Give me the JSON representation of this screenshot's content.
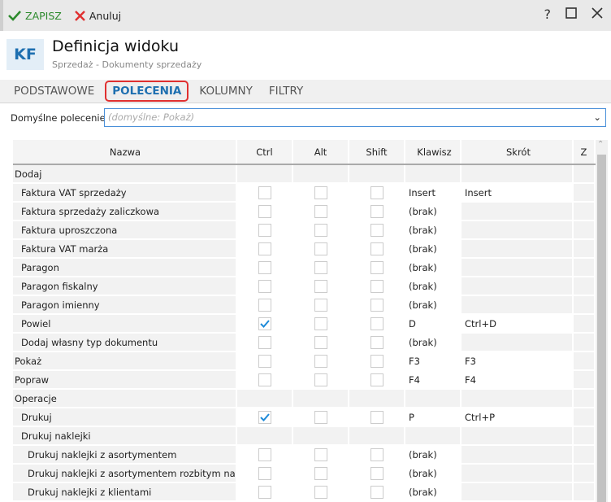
{
  "toolbar": {
    "save": "ZAPISZ",
    "cancel": "Anuluj",
    "help": "?"
  },
  "header": {
    "logo": "KF",
    "title": "Definicja widoku",
    "subtitle": "Sprzedaż - Dokumenty sprzedaży"
  },
  "tabs": [
    {
      "label": "PODSTAWOWE"
    },
    {
      "label": "POLECENIA",
      "active": true
    },
    {
      "label": "KOLUMNY"
    },
    {
      "label": "FILTRY"
    }
  ],
  "default_command": {
    "label": "Domyślne polecenie:",
    "placeholder": "(domyślne: Pokaż)"
  },
  "columns": [
    "Nazwa",
    "Ctrl",
    "Alt",
    "Shift",
    "Klawisz",
    "Skrót",
    "Z"
  ],
  "rows": [
    {
      "name": "Dodaj",
      "level": 0,
      "group": true
    },
    {
      "name": "Faktura VAT sprzedaży",
      "level": 1,
      "ctrl": false,
      "alt": false,
      "shift": false,
      "key": "Insert",
      "shortcut": "Insert"
    },
    {
      "name": "Faktura sprzedaży zaliczkowa",
      "level": 1,
      "ctrl": false,
      "alt": false,
      "shift": false,
      "key": "(brak)",
      "shortcut": ""
    },
    {
      "name": "Faktura uproszczona",
      "level": 1,
      "ctrl": false,
      "alt": false,
      "shift": false,
      "key": "(brak)",
      "shortcut": ""
    },
    {
      "name": "Faktura VAT marża",
      "level": 1,
      "ctrl": false,
      "alt": false,
      "shift": false,
      "key": "(brak)",
      "shortcut": ""
    },
    {
      "name": "Paragon",
      "level": 1,
      "ctrl": false,
      "alt": false,
      "shift": false,
      "key": "(brak)",
      "shortcut": ""
    },
    {
      "name": "Paragon fiskalny",
      "level": 1,
      "ctrl": false,
      "alt": false,
      "shift": false,
      "key": "(brak)",
      "shortcut": ""
    },
    {
      "name": "Paragon imienny",
      "level": 1,
      "ctrl": false,
      "alt": false,
      "shift": false,
      "key": "(brak)",
      "shortcut": ""
    },
    {
      "name": "Powiel",
      "level": 1,
      "ctrl": true,
      "alt": false,
      "shift": false,
      "key": "D",
      "shortcut": "Ctrl+D"
    },
    {
      "name": "Dodaj własny typ dokumentu",
      "level": 1,
      "ctrl": false,
      "alt": false,
      "shift": false,
      "key": "(brak)",
      "shortcut": ""
    },
    {
      "name": "Pokaż",
      "level": 0,
      "ctrl": false,
      "alt": false,
      "shift": false,
      "key": "F3",
      "shortcut": "F3"
    },
    {
      "name": "Popraw",
      "level": 0,
      "ctrl": false,
      "alt": false,
      "shift": false,
      "key": "F4",
      "shortcut": "F4"
    },
    {
      "name": "Operacje",
      "level": 0,
      "group": true
    },
    {
      "name": "Drukuj",
      "level": 1,
      "ctrl": true,
      "alt": false,
      "shift": false,
      "key": "P",
      "shortcut": "Ctrl+P"
    },
    {
      "name": "Drukuj naklejki",
      "level": 1,
      "group": true
    },
    {
      "name": "Drukuj naklejki z asortymentem",
      "level": 2,
      "ctrl": false,
      "alt": false,
      "shift": false,
      "key": "(brak)",
      "shortcut": ""
    },
    {
      "name": "Drukuj naklejki z asortymentem rozbitym na p...",
      "level": 2,
      "ctrl": false,
      "alt": false,
      "shift": false,
      "key": "(brak)",
      "shortcut": ""
    },
    {
      "name": "Drukuj naklejki z klientami",
      "level": 2,
      "ctrl": false,
      "alt": false,
      "shift": false,
      "key": "(brak)",
      "shortcut": ""
    }
  ]
}
